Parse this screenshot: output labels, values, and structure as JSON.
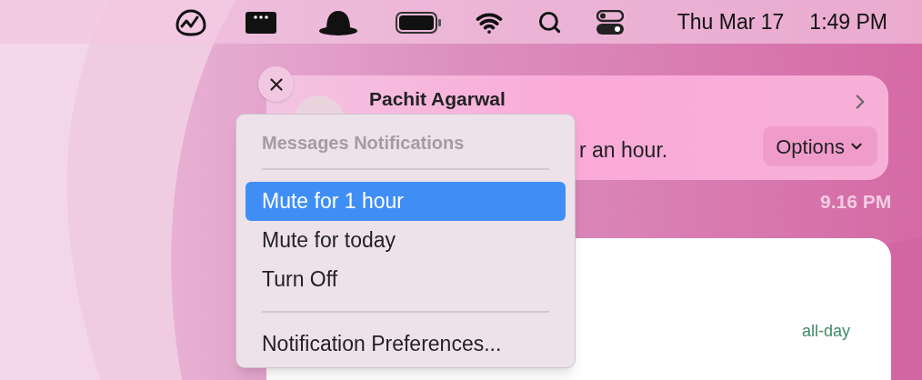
{
  "menu_bar": {
    "date": "Thu Mar 17",
    "time": "1:49 PM"
  },
  "notification": {
    "sender": "Pachit Agarwal",
    "message": "r an hour.",
    "options_label": "Options",
    "time": "9.16 PM"
  },
  "calendar_card": {
    "label": "all-day"
  },
  "context_menu": {
    "entries": [
      {
        "kind": "header",
        "label": "Messages Notifications"
      },
      {
        "kind": "separator"
      },
      {
        "kind": "item",
        "label": "Mute for 1 hour",
        "selected": true
      },
      {
        "kind": "item",
        "label": "Mute for today",
        "selected": false
      },
      {
        "kind": "item",
        "label": "Turn Off",
        "selected": false
      },
      {
        "kind": "separator"
      },
      {
        "kind": "item",
        "label": "Notification Preferences...",
        "selected": false
      }
    ]
  }
}
